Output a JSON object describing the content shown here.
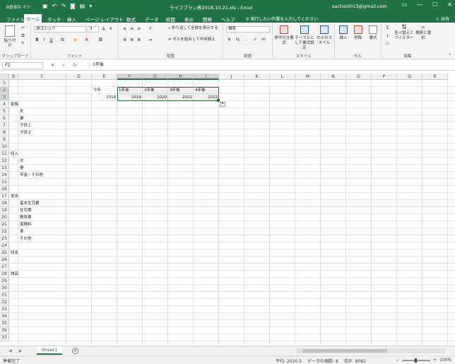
{
  "title_bar": {
    "autosave_label": "自動保存",
    "autosave_state": "オフ",
    "document_title": "ライフプラン表2018.10.21.xls  -  Excel",
    "account": "sachio0013@gmail.com"
  },
  "menu_tabs": [
    {
      "label": "ファイル",
      "active": false
    },
    {
      "label": "ホーム",
      "active": true
    },
    {
      "label": "タッチ",
      "active": false
    },
    {
      "label": "挿入",
      "active": false
    },
    {
      "label": "ページ レイアウト",
      "active": false
    },
    {
      "label": "数式",
      "active": false
    },
    {
      "label": "データ",
      "active": false
    },
    {
      "label": "校閲",
      "active": false
    },
    {
      "label": "表示",
      "active": false
    },
    {
      "label": "開発",
      "active": false
    },
    {
      "label": "ヘルプ",
      "active": false
    }
  ],
  "tell_me": "実行したい作業を入力してください",
  "share_label": "共有",
  "ribbon": {
    "clipboard": {
      "paste": "貼り付け",
      "group": "クリップボード"
    },
    "font": {
      "name": "游ゴシック",
      "size": "9",
      "group": "フォント"
    },
    "alignment": {
      "wrap": "折り返して全体を表示する",
      "merge": "セルを結合して中央揃え",
      "group": "配置"
    },
    "number": {
      "format": "標準",
      "group": "数値"
    },
    "styles": {
      "conditional": "条件付き書式",
      "as_table": "テーブルとして書式設定",
      "cell_styles": "セルのスタイル",
      "group": "スタイル"
    },
    "cells": {
      "insert": "挿入",
      "delete": "削除",
      "format": "書式",
      "group": "セル"
    },
    "editing": {
      "sort": "並べ替えとフィルター",
      "find": "検索と選択",
      "group": "編集"
    }
  },
  "formula_bar": {
    "name_box": "F2",
    "content": "1年後"
  },
  "columns": [
    "B",
    "C",
    "D",
    "E",
    "F",
    "G",
    "H",
    "I",
    "J",
    "K",
    "L",
    "M",
    "N",
    "O",
    "P",
    "Q",
    "R"
  ],
  "rows": [
    "1",
    "2",
    "3",
    "4",
    "5",
    "6",
    "7",
    "8",
    "9",
    "10",
    "11",
    "12",
    "13",
    "14",
    "15",
    "16",
    "17",
    "18",
    "19",
    "20",
    "21",
    "22",
    "23",
    "24",
    "25",
    "26",
    "27",
    "28",
    "29",
    "30",
    "31",
    "32",
    "33",
    "34",
    "35",
    "36",
    "37"
  ],
  "cells": {
    "e2": "今年",
    "f2": "1年後",
    "g2": "2年後",
    "h2": "3年後",
    "i2": "4年後",
    "e3": "2018",
    "f3": "2019",
    "g3": "2020",
    "h3": "2021",
    "i3": "2022",
    "b4": "家族",
    "c5": "夫",
    "c6": "妻",
    "c7": "子供１",
    "c8": "子供２",
    "b11": "収入",
    "c12": "夫",
    "c13": "妻",
    "c14": "年金・その他",
    "b17": "支出",
    "c18": "基本生活費",
    "c19": "住宅費",
    "c20": "教育費",
    "c21": "保険料",
    "c22": "車",
    "c23": "その他",
    "b25": "収支",
    "b28": "残高"
  },
  "sheet_tab": "Sheet1",
  "status": {
    "ready": "準備完了",
    "average": "平均: 2020.5",
    "count": "データの個数: 8",
    "sum": "合計: 8082",
    "zoom": "100%"
  }
}
